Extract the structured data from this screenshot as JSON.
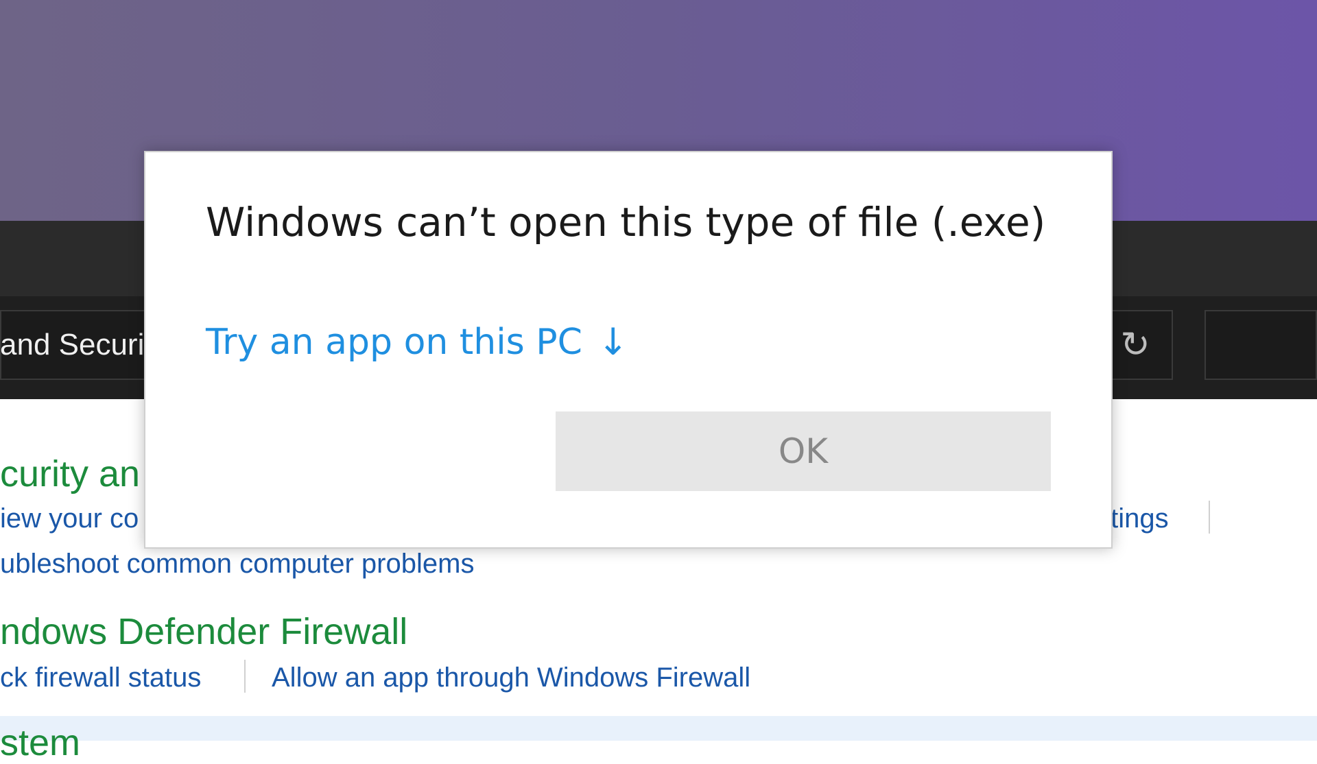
{
  "background_window": {
    "breadcrumb": "and Securit",
    "refresh_icon": "↻",
    "sections": {
      "security": {
        "title": "curity an",
        "link_left": "iew your co",
        "link_right": "ttings",
        "link_troubleshoot": "ubleshoot common computer problems"
      },
      "firewall": {
        "title": "ndows Defender Firewall",
        "link_status": "ck firewall status",
        "link_allow": "Allow an app through Windows Firewall"
      },
      "system": {
        "title": "stem"
      }
    }
  },
  "dialog": {
    "title": "Windows can’t open this type of file (.exe)",
    "try_app_label": "Try an app on this PC",
    "try_app_arrow": "↓",
    "ok_label": "OK"
  },
  "colors": {
    "link_blue": "#1f8fe0",
    "section_green": "#1c8b3c",
    "control_panel_link": "#1a57a8"
  }
}
